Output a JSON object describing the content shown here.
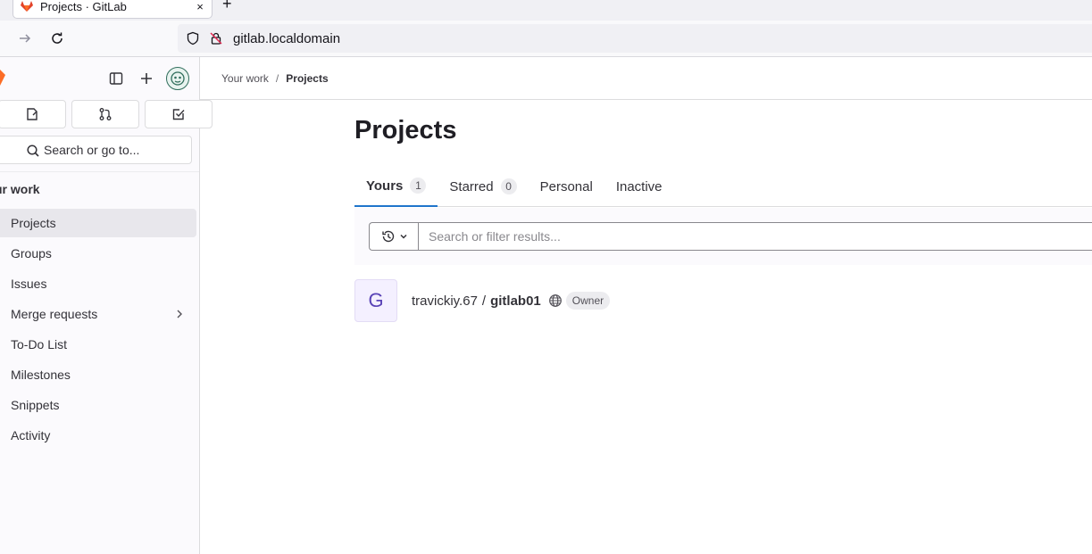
{
  "browser": {
    "tab_title": "Projects · GitLab",
    "tab_close": "×",
    "new_tab": "+",
    "url": "gitlab.localdomain"
  },
  "sidebar": {
    "search_label": "Search or go to...",
    "section_title": "ur work",
    "items": [
      {
        "label": "Projects",
        "active": true
      },
      {
        "label": "Groups"
      },
      {
        "label": "Issues"
      },
      {
        "label": "Merge requests",
        "has_submenu": true
      },
      {
        "label": "To-Do List"
      },
      {
        "label": "Milestones"
      },
      {
        "label": "Snippets"
      },
      {
        "label": "Activity"
      }
    ]
  },
  "breadcrumb": {
    "parent": "Your work",
    "separator": "/",
    "current": "Projects"
  },
  "page": {
    "title": "Projects",
    "tabs": [
      {
        "label": "Yours",
        "count": "1",
        "active": true
      },
      {
        "label": "Starred",
        "count": "0"
      },
      {
        "label": "Personal"
      },
      {
        "label": "Inactive"
      }
    ],
    "filter_placeholder": "Search or filter results..."
  },
  "projects": [
    {
      "avatar_letter": "G",
      "namespace": "travickiy.67",
      "separator": "/",
      "name": "gitlab01",
      "visibility_icon": "globe-icon",
      "role": "Owner"
    }
  ],
  "colors": {
    "accent": "#1f75cb",
    "sidebar_bg": "#fbfafd",
    "project_avatar_bg": "#f4f0ff"
  }
}
